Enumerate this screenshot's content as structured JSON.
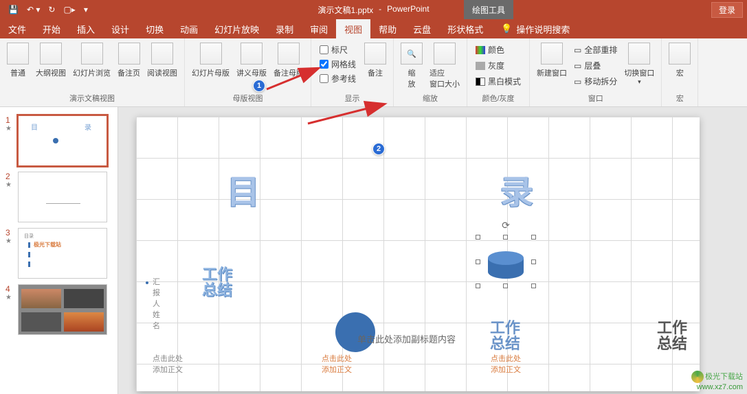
{
  "titlebar": {
    "file_name": "演示文稿1.pptx",
    "app_name": "PowerPoint",
    "contextual_tab": "绘图工具",
    "login": "登录"
  },
  "tabs": {
    "file": "文件",
    "home": "开始",
    "insert": "插入",
    "design": "设计",
    "transitions": "切换",
    "animations": "动画",
    "slideshow": "幻灯片放映",
    "record": "录制",
    "review": "审阅",
    "view": "视图",
    "help": "帮助",
    "yunpan": "云盘",
    "shape_format": "形状格式",
    "tell_me": "操作说明搜索"
  },
  "ribbon": {
    "presentation_views": {
      "label": "演示文稿视图",
      "normal": "普通",
      "outline": "大纲视图",
      "sorter": "幻灯片浏览",
      "notes_page": "备注页",
      "reading": "阅读视图"
    },
    "master_views": {
      "label": "母版视图",
      "slide_master": "幻灯片母版",
      "handout_master": "讲义母版",
      "notes_master": "备注母版"
    },
    "show": {
      "label": "显示",
      "ruler": "标尺",
      "gridlines": "网格线",
      "guides": "参考线",
      "notes": "备注"
    },
    "zoom": {
      "label": "缩放",
      "zoom": "缩\n放",
      "fit": "适应\n窗口大小"
    },
    "color": {
      "label": "颜色/灰度",
      "color": "颜色",
      "gray": "灰度",
      "bw": "黑白模式"
    },
    "window": {
      "label": "窗口",
      "new_window": "新建窗口",
      "arrange_all": "全部重排",
      "cascade": "层叠",
      "move_split": "移动拆分",
      "switch": "切换窗口"
    },
    "macros": {
      "label": "宏",
      "macros": "宏"
    }
  },
  "thumbs": {
    "1": "1",
    "2": "2",
    "3": "3",
    "4": "4"
  },
  "slide": {
    "mu": "目",
    "lu": "录",
    "reporter_label": "汇报人姓名",
    "work_summary_a": "工作",
    "work_summary_b": "总结",
    "subtitle_prompt": "单击此处添加副标题内容",
    "click_add_1": "点击此处",
    "click_add_2": "添加正文"
  },
  "annotations": {
    "one": "1",
    "two": "2"
  },
  "watermark": {
    "site": "极光下载站",
    "url": "www.xz7.com"
  }
}
